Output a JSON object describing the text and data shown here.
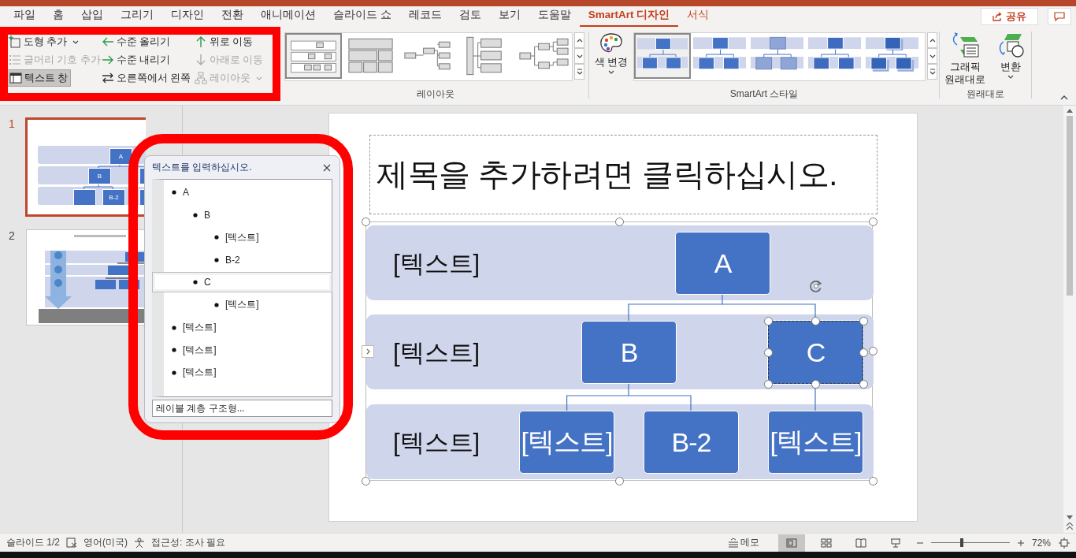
{
  "tabs": [
    {
      "label": "파일",
      "selected": false,
      "contextual": false
    },
    {
      "label": "홈",
      "selected": false,
      "contextual": false
    },
    {
      "label": "삽입",
      "selected": false,
      "contextual": false
    },
    {
      "label": "그리기",
      "selected": false,
      "contextual": false
    },
    {
      "label": "디자인",
      "selected": false,
      "contextual": false
    },
    {
      "label": "전환",
      "selected": false,
      "contextual": false
    },
    {
      "label": "애니메이션",
      "selected": false,
      "contextual": false
    },
    {
      "label": "슬라이드 쇼",
      "selected": false,
      "contextual": false
    },
    {
      "label": "레코드",
      "selected": false,
      "contextual": false
    },
    {
      "label": "검토",
      "selected": false,
      "contextual": false
    },
    {
      "label": "보기",
      "selected": false,
      "contextual": false
    },
    {
      "label": "도움말",
      "selected": false,
      "contextual": false
    },
    {
      "label": "SmartArt 디자인",
      "selected": true,
      "contextual": true
    },
    {
      "label": "서식",
      "selected": false,
      "contextual": true
    }
  ],
  "share_button": "공유",
  "ribbon": {
    "create_graphic": [
      {
        "label": "도형 추가",
        "disabled": false,
        "pressed": false,
        "dropdown": true
      },
      {
        "label": "글머리 기호 추가",
        "disabled": true,
        "pressed": false,
        "dropdown": false
      },
      {
        "label": "텍스트 창",
        "disabled": false,
        "pressed": true,
        "dropdown": false
      },
      {
        "label": "수준 올리기",
        "disabled": false,
        "pressed": false,
        "dropdown": false
      },
      {
        "label": "수준 내리기",
        "disabled": false,
        "pressed": false,
        "dropdown": false
      },
      {
        "label": "오른쪽에서 왼쪽",
        "disabled": false,
        "pressed": false,
        "dropdown": false
      },
      {
        "label": "위로 이동",
        "disabled": false,
        "pressed": false,
        "dropdown": false
      },
      {
        "label": "아래로 이동",
        "disabled": true,
        "pressed": false,
        "dropdown": false
      },
      {
        "label": "레이아웃",
        "disabled": true,
        "pressed": false,
        "dropdown": true
      }
    ],
    "layouts": {
      "label": "레이아웃",
      "items": [
        {
          "selected": true
        },
        {
          "selected": false
        },
        {
          "selected": false
        },
        {
          "selected": false
        },
        {
          "selected": false
        }
      ]
    },
    "color_button": "색 변경",
    "styles": {
      "label": "SmartArt 스타일",
      "items": [
        {
          "selected": true
        },
        {
          "selected": false
        },
        {
          "selected": false
        },
        {
          "selected": false
        },
        {
          "selected": false
        }
      ]
    },
    "reset": {
      "label": "원래대로",
      "buttons": [
        {
          "label": "그래픽 원래대로",
          "dropdown": false
        },
        {
          "label": "변환",
          "dropdown": true
        }
      ]
    }
  },
  "slides": [
    {
      "number": "1",
      "selected": true,
      "labels": [
        "A",
        "B",
        "B-2"
      ]
    },
    {
      "number": "2",
      "selected": false
    }
  ],
  "slide": {
    "title_placeholder": "제목을 추가하려면 클릭하십시오.",
    "row_labels": [
      "[텍스트]",
      "[텍스트]",
      "[텍스트]"
    ],
    "nodes": [
      {
        "text": "A",
        "selected": false
      },
      {
        "text": "B",
        "selected": false
      },
      {
        "text": "C",
        "selected": true
      },
      {
        "text": "[텍스트]",
        "selected": false
      },
      {
        "text": "B-2",
        "selected": false
      },
      {
        "text": "[텍스트]",
        "selected": false
      }
    ]
  },
  "text_pane": {
    "title": "텍스트를 입력하십시오.",
    "items": [
      {
        "text": "A",
        "selected": false,
        "children": [
          {
            "text": "B",
            "selected": false,
            "children": [
              {
                "text": "[텍스트]",
                "selected": false
              },
              {
                "text": "B-2",
                "selected": false
              }
            ]
          },
          {
            "text": "C",
            "selected": true,
            "children": [
              {
                "text": "[텍스트]",
                "selected": false
              }
            ]
          }
        ]
      },
      {
        "text": "[텍스트]",
        "selected": false
      },
      {
        "text": "[텍스트]",
        "selected": false
      },
      {
        "text": "[텍스트]",
        "selected": false
      }
    ],
    "footer": "레이블 계층 구조형..."
  },
  "annotations": [
    {
      "kind": "box"
    },
    {
      "kind": "rounded-box"
    }
  ],
  "status_bar": {
    "slide_count": "슬라이드 1/2",
    "language": "영어(미국)",
    "accessibility": "접근성: 조사 필요",
    "notes": "메모",
    "views": [
      {
        "selected": true
      },
      {
        "selected": false
      },
      {
        "selected": false
      },
      {
        "selected": false
      }
    ],
    "zoom": {
      "level": 0.37
    },
    "zoom_text": "72%"
  }
}
